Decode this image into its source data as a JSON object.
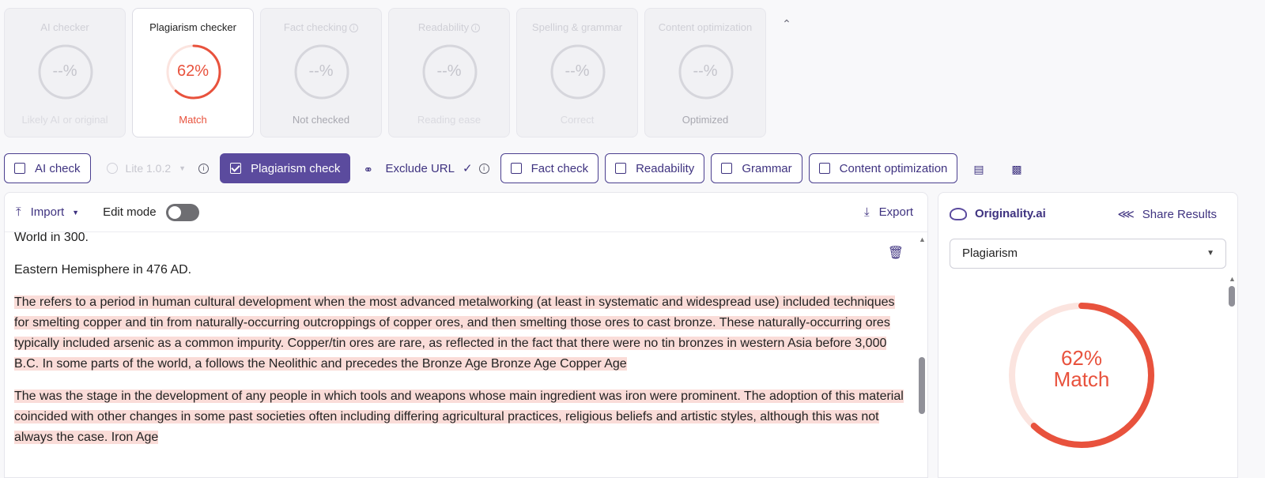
{
  "cards": [
    {
      "title": "AI checker",
      "value": "--%",
      "footer": "Likely AI or original"
    },
    {
      "title": "Plagiarism checker",
      "value": "62%",
      "footer": "Match",
      "percent": 62,
      "color": "#e8523d"
    },
    {
      "title": "Fact checking",
      "value": "--%",
      "footer": "Not checked"
    },
    {
      "title": "Readability",
      "value": "--%",
      "footer": "Reading ease"
    },
    {
      "title": "Spelling & grammar",
      "value": "--%",
      "footer": "Correct"
    },
    {
      "title": "Content optimization",
      "value": "--%",
      "footer": "Optimized"
    }
  ],
  "toolbar": {
    "ai_check": "AI check",
    "lite_model": "Lite 1.0.2",
    "plagiarism_check": "Plagiarism check",
    "exclude_url": "Exclude URL",
    "fact_check": "Fact check",
    "readability": "Readability",
    "grammar": "Grammar",
    "content_optimization": "Content optimization"
  },
  "editor": {
    "import_label": "Import",
    "edit_mode_label": "Edit mode",
    "edit_mode_on": false,
    "export_label": "Export",
    "paragraphs": [
      {
        "text": "World in 300.",
        "highlighted": false
      },
      {
        "text": "Eastern Hemisphere in 476 AD.",
        "highlighted": false
      },
      {
        "text": "The refers to a period in human cultural development when the most advanced metalworking (at least in systematic and widespread use) included techniques for smelting copper and tin from naturally-occurring outcroppings of copper ores, and then smelting those ores to cast bronze. These naturally-occurring ores typically included arsenic as a common impurity. Copper/tin ores are rare, as reflected in the fact that there were no tin bronzes in western Asia before 3,000 B.C. In some parts of the world, a follows the Neolithic and precedes the Bronze Age Bronze Age Copper Age",
        "highlighted": true
      },
      {
        "text": "The was the stage in the development of any people in which tools and weapons whose main ingredient was iron were prominent. The adoption of this material coincided with other changes in some past societies often including differing agricultural practices, religious beliefs and artistic styles, although this was not always the case. Iron Age",
        "highlighted": true
      }
    ]
  },
  "side": {
    "brand": "Originality.ai",
    "share_label": "Share Results",
    "select_value": "Plagiarism",
    "score_value": "62%",
    "score_label": "Match",
    "score_percent": 62,
    "score_color": "#e8523d"
  },
  "colors": {
    "accent": "#5b4b9e",
    "match": "#e8523d",
    "highlight": "#fadcd8"
  }
}
